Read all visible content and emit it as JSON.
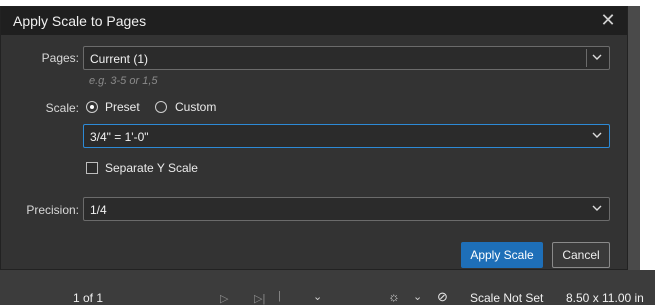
{
  "dialog": {
    "title": "Apply Scale to Pages",
    "pages": {
      "label": "Pages:",
      "value": "Current (1)",
      "hint": "e.g. 3-5 or 1,5"
    },
    "scale": {
      "label": "Scale:",
      "options": [
        "Preset",
        "Custom"
      ],
      "selected": "Preset",
      "preset_value": "3/4\" = 1'-0\""
    },
    "separate_y": {
      "label": "Separate Y Scale",
      "checked": false
    },
    "precision": {
      "label": "Precision:",
      "value": "1/4"
    },
    "buttons": {
      "apply": "Apply Scale",
      "cancel": "Cancel"
    },
    "close_icon": "close-icon"
  },
  "statusbar": {
    "page_indicator": "1 of 1",
    "scale_status": "Scale Not Set",
    "page_size": "8.50 x 11.00 in"
  },
  "colors": {
    "dialog_bg": "#333333",
    "titlebar_bg": "#1f1f1f",
    "accent": "#1e6fb8",
    "focus_border": "#2d8ad6"
  }
}
